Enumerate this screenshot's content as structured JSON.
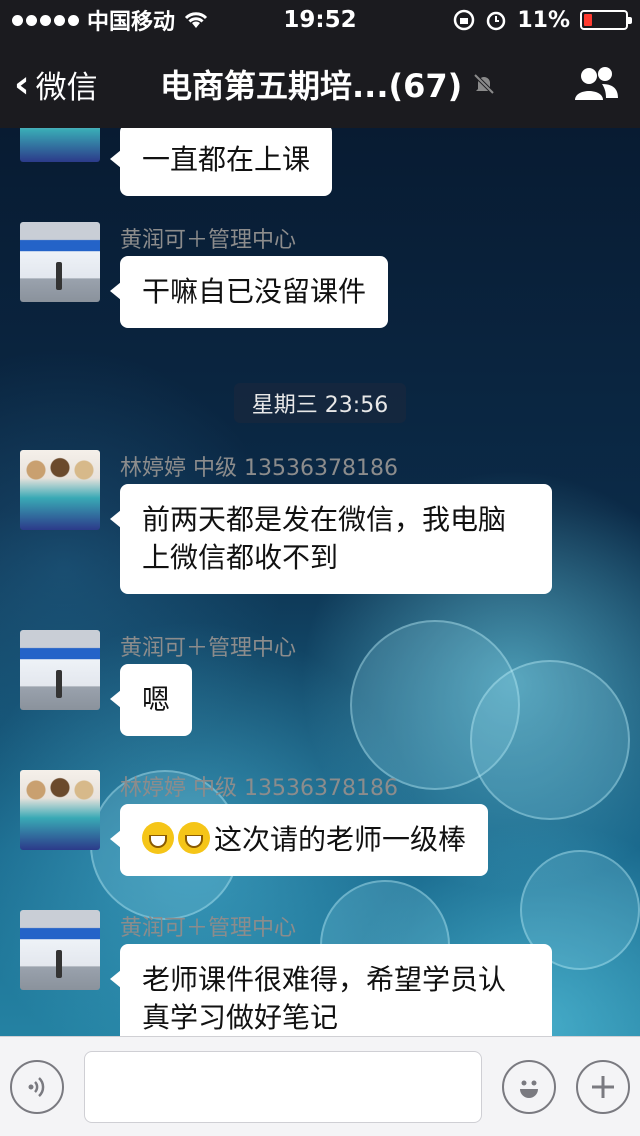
{
  "status_bar": {
    "carrier": "中国移动",
    "time": "19:52",
    "battery_percent": "11%"
  },
  "nav": {
    "back_label": "微信",
    "title": "电商第五期培...(67)"
  },
  "messages": [
    {
      "sender": "",
      "text": "一直都在上课",
      "avatar": "girls"
    },
    {
      "sender": "黄润可＋管理中心",
      "text": "干嘛自已没留课件",
      "avatar": "hall"
    },
    {
      "sender": "林婷婷 中级 13536378186",
      "text": "前两天都是发在微信，我电脑上微信都收不到",
      "avatar": "girls"
    },
    {
      "sender": "黄润可＋管理中心",
      "text": "嗯",
      "avatar": "hall"
    },
    {
      "sender": "林婷婷 中级 13536378186",
      "text": "这次请的老师一级棒",
      "avatar": "girls",
      "emoji_prefix": "grin-emoji x2"
    },
    {
      "sender": "黄润可＋管理中心",
      "text": "老师课件很难得，希望学员认真学习做好笔记",
      "avatar": "hall"
    }
  ],
  "time_divider": "星期三 23:56",
  "icons": {
    "voice": "voice-icon",
    "emoji": "emoji-icon",
    "add": "plus-icon",
    "group": "group-members-icon",
    "mute": "muted-bell-icon"
  },
  "colors": {
    "nav_bg": "#1b1b1f",
    "bubble_bg": "#ffffff",
    "battery_low": "#ff3b30"
  }
}
